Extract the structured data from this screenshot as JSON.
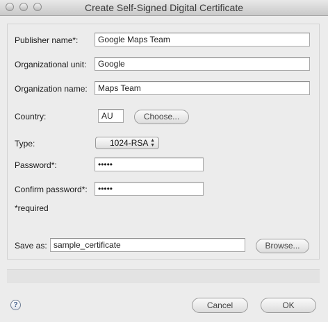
{
  "window": {
    "title": "Create Self-Signed Digital Certificate"
  },
  "form": {
    "publisher_name": {
      "label": "Publisher name*:",
      "value": "Google Maps Team"
    },
    "organizational_unit": {
      "label": "Organizational unit:",
      "value": "Google"
    },
    "organization_name": {
      "label": "Organization name:",
      "value": "Maps Team"
    },
    "country": {
      "label": "Country:",
      "value": "AU",
      "choose_label": "Choose..."
    },
    "type": {
      "label": "Type:",
      "selected": "1024-RSA"
    },
    "password": {
      "label": "Password*:",
      "value": "•••••"
    },
    "confirm_password": {
      "label": "Confirm password*:",
      "value": "•••••"
    },
    "required_note": "*required"
  },
  "save": {
    "label": "Save as:",
    "value": "sample_certificate",
    "browse_label": "Browse..."
  },
  "footer": {
    "help_label": "?",
    "cancel_label": "Cancel",
    "ok_label": "OK"
  },
  "colors": {
    "window_bg": "#ececec",
    "titlebar_top": "#e8e8e8",
    "titlebar_bottom": "#c9c9c9",
    "input_border": "#a9a9a9"
  },
  "icons": {
    "help": "question-mark-icon",
    "traffic_lights": [
      "close-icon",
      "minimize-icon",
      "zoom-icon"
    ]
  }
}
